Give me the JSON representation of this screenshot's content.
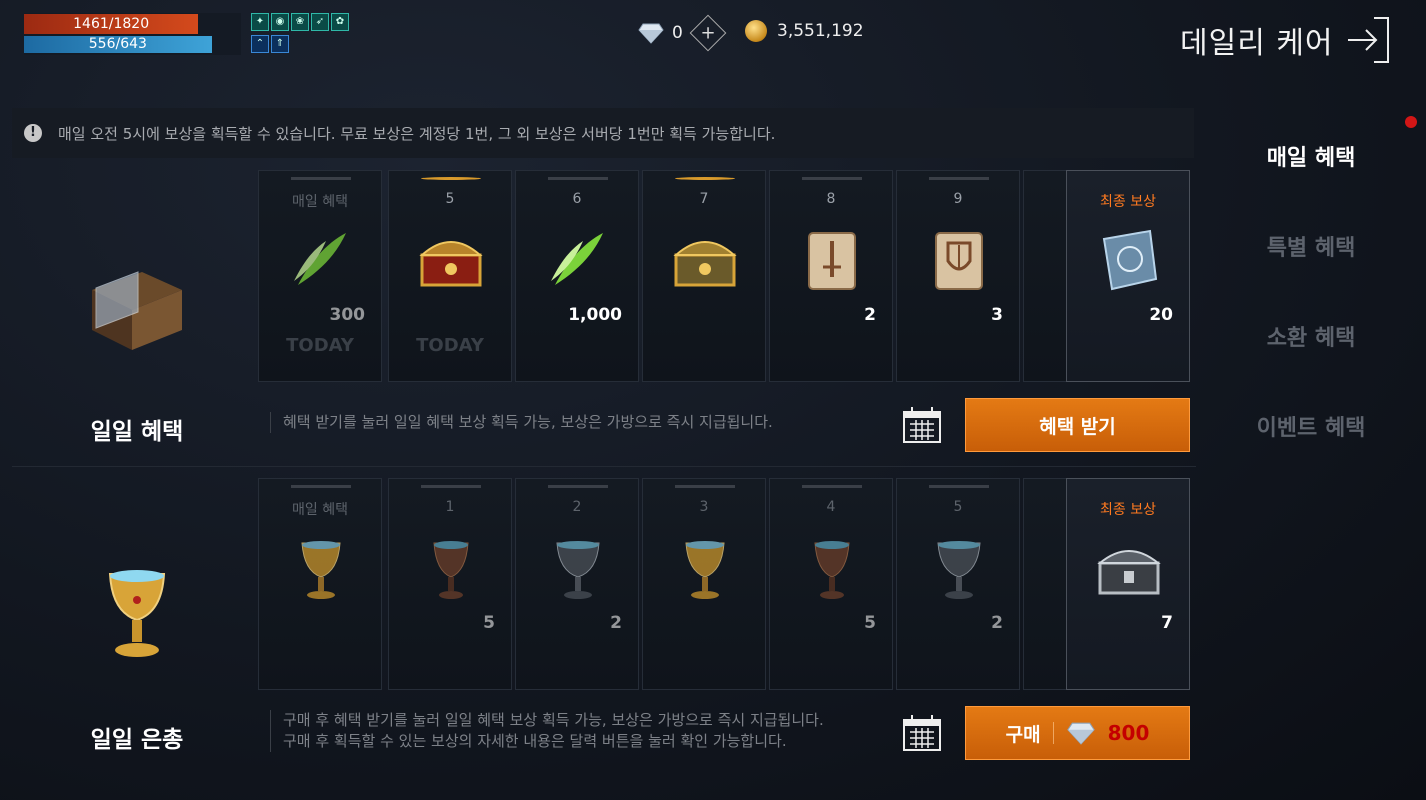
{
  "hud": {
    "hp": "1461/1820",
    "mp": "556/643",
    "hp_fraction": 0.803,
    "mp_fraction": 0.865,
    "buffs": [
      "buff-1",
      "buff-2",
      "buff-3",
      "buff-4",
      "buff-5",
      "buff-6",
      "buff-7"
    ],
    "diamonds": "0",
    "gold": "3,551,192"
  },
  "header": {
    "title": "데일리 케어"
  },
  "notice": {
    "text": "매일 오전 5시에 보상을 획득할 수 있습니다. 무료 보상은 계정당 1번, 그 외 보상은 서버당 1번만 획득 가능합니다."
  },
  "sidebar": {
    "items": [
      {
        "label": "매일 혜택",
        "active": true
      },
      {
        "label": "특별 혜택",
        "active": false
      },
      {
        "label": "소환 혜택",
        "active": false
      },
      {
        "label": "이벤트 혜택",
        "active": false
      }
    ]
  },
  "daily": {
    "label": "일일 혜택",
    "cards": [
      {
        "title": "매일 혜택",
        "qty": "300",
        "today": "TODAY",
        "icon": "green-feather-icon"
      },
      {
        "title": "5",
        "qty": "",
        "today": "TODAY",
        "icon": "golden-chest-icon"
      },
      {
        "title": "6",
        "qty": "1,000",
        "today": "",
        "icon": "green-feather-icon"
      },
      {
        "title": "7",
        "qty": "",
        "today": "",
        "icon": "golden-chest-icon"
      },
      {
        "title": "8",
        "qty": "2",
        "today": "",
        "icon": "sword-scroll-icon"
      },
      {
        "title": "9",
        "qty": "3",
        "today": "",
        "icon": "shield-scroll-icon"
      }
    ],
    "final": {
      "title": "최종 보상",
      "qty": "20",
      "icon": "crystal-scroll-icon"
    },
    "desc": "혜택 받기를 눌러 일일 혜택 보상 획득 가능, 보상은 가방으로 즉시 지급됩니다.",
    "button": "혜택 받기"
  },
  "premium": {
    "label": "일일 은총",
    "cards": [
      {
        "title": "매일 혜택",
        "qty": "",
        "icon": "gold-chalice-icon"
      },
      {
        "title": "1",
        "qty": "5",
        "icon": "bronze-chalice-icon"
      },
      {
        "title": "2",
        "qty": "2",
        "icon": "silver-chalice-icon"
      },
      {
        "title": "3",
        "qty": "",
        "icon": "gold-chalice-icon"
      },
      {
        "title": "4",
        "qty": "5",
        "icon": "bronze-chalice-icon"
      },
      {
        "title": "5",
        "qty": "2",
        "icon": "silver-chalice-icon"
      }
    ],
    "final": {
      "title": "최종 보상",
      "qty": "7",
      "icon": "silver-chest-icon"
    },
    "desc1": "구매 후 혜택 받기를 눌러 일일 혜택 보상 획득 가능, 보상은 가방으로 즉시 지급됩니다.",
    "desc2": "구매 후 획득할 수 있는 보상의 자세한 내용은 달력 버튼을 눌러 확인 가능합니다.",
    "button": "구매",
    "price": "800"
  },
  "colors": {
    "accent": "#e47a14",
    "final_label": "#ff7a20",
    "price": "#c40000",
    "active": "#ffffff",
    "inactive": "#5d636d"
  }
}
